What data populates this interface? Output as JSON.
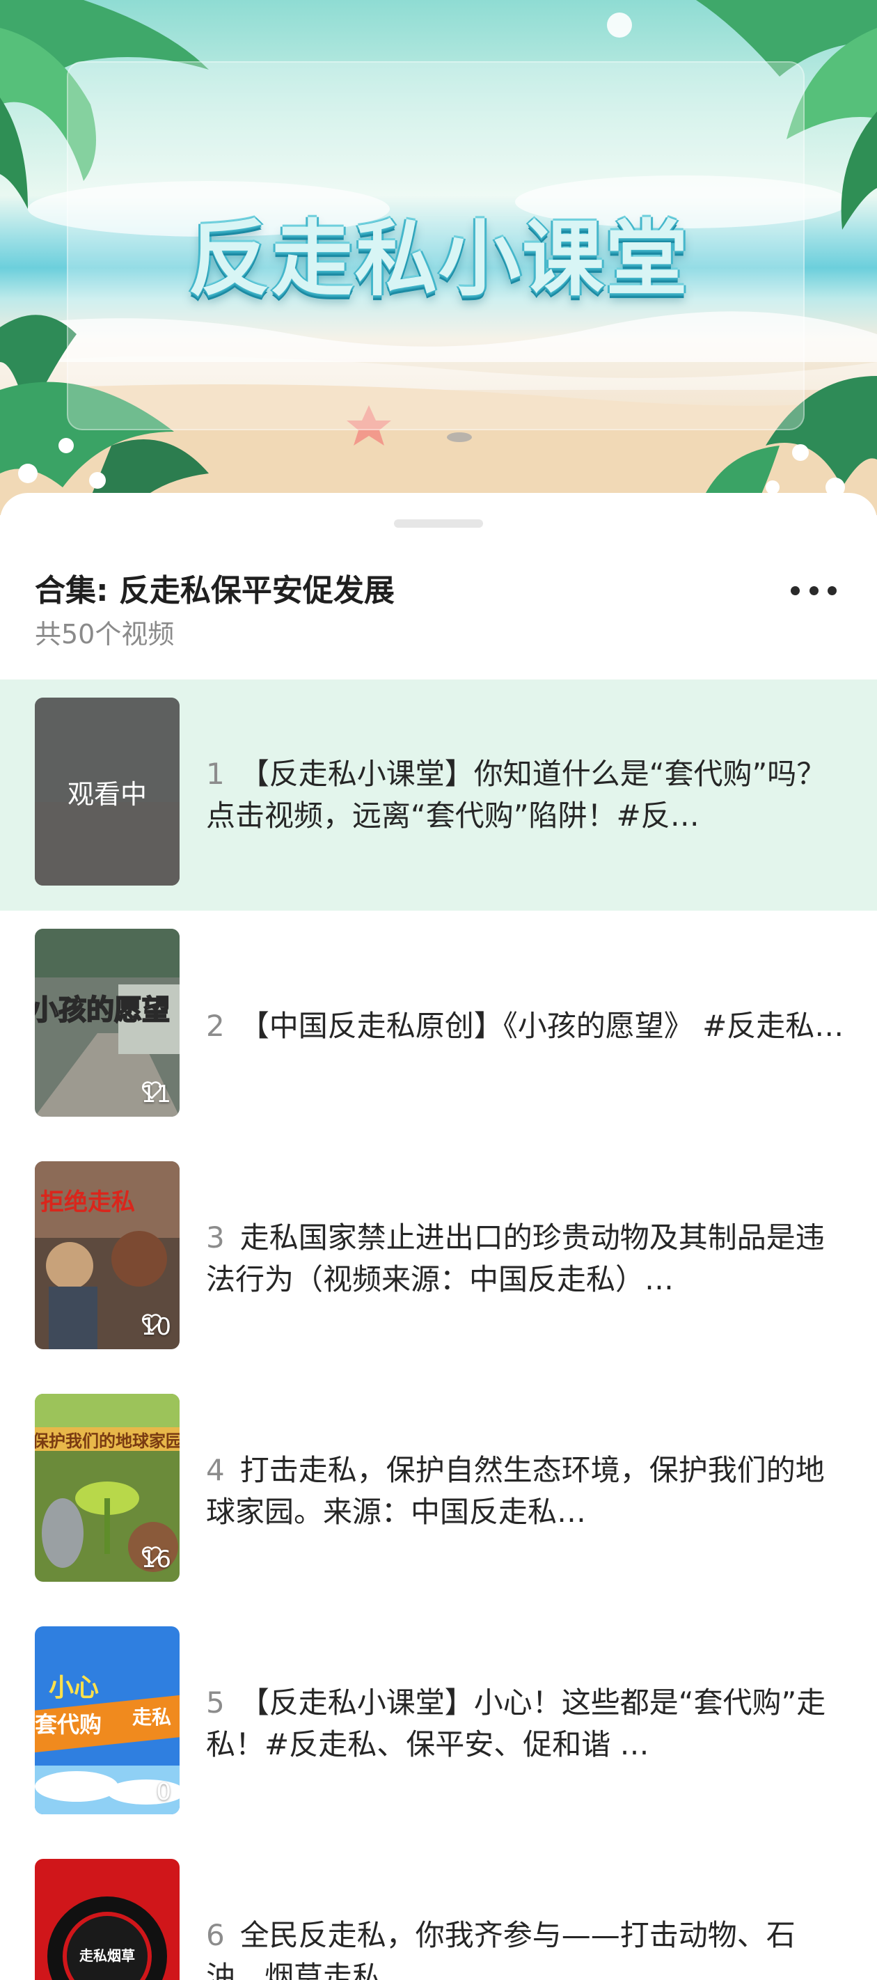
{
  "banner": {
    "title": "反走私小课堂"
  },
  "playlist": {
    "title": "合集: 反走私保平安促发展",
    "count_text": "共50个视频",
    "more_icon": "more-horizontal-icon",
    "items": [
      {
        "index": "1",
        "title": "【反走私小课堂】你知道什么是“套代购”吗？点击视频，远离“套代购”陷阱！#反…",
        "status": "观看中",
        "likes": ""
      },
      {
        "index": "2",
        "title": "【中国反走私原创】《小孩的愿望》 #反走私…",
        "status": "",
        "likes": "11"
      },
      {
        "index": "3",
        "title": "走私国家禁止进出口的珍贵动物及其制品是违法行为（视频来源：中国反走私）…",
        "status": "",
        "likes": "10"
      },
      {
        "index": "4",
        "title": "打击走私，保护自然生态环境，保护我们的地球家园。来源：中国反走私…",
        "status": "",
        "likes": "16"
      },
      {
        "index": "5",
        "title": "【反走私小课堂】小心！这些都是“套代购”走私！#反走私、保平安、促和谐 …",
        "status": "",
        "likes": "0"
      },
      {
        "index": "6",
        "title": "全民反走私，你我齐参与——打击动物、石油、烟草走私",
        "status": "",
        "likes": ""
      }
    ]
  },
  "thumb_captions": {
    "t2": "小孩的愿望",
    "t3": "拒绝走私",
    "t4": "保护我们的地球家园",
    "t5a": "小心",
    "t5b": "套代购",
    "t5c": "走私",
    "t6": "走私烟草"
  },
  "colors": {
    "active_row_bg": "#e3f5ec",
    "title_text": "#262626",
    "index_text": "#8c8c8c"
  }
}
